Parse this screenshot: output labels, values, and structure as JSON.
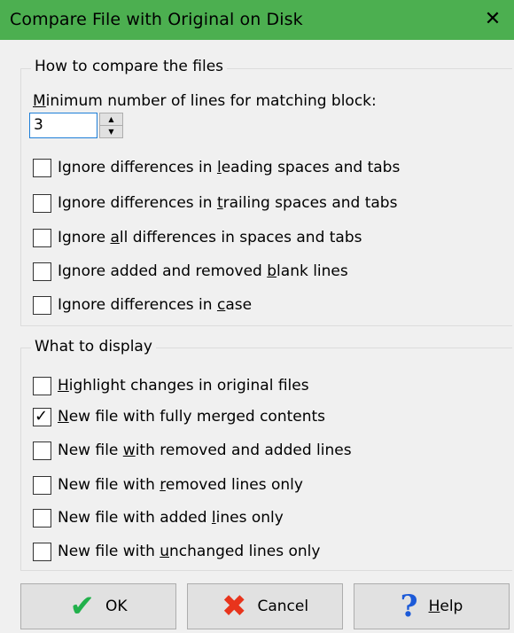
{
  "window": {
    "title": "Compare File with Original on Disk",
    "close_glyph": "✕"
  },
  "compare_group": {
    "legend": "How to compare the files",
    "min_lines_label_mnemonic": "M",
    "min_lines_label_rest": "inimum number of lines for matching block:",
    "min_lines_value": "3",
    "options": [
      {
        "pre": "Ignore differences in ",
        "key": "l",
        "post": "eading spaces and tabs",
        "checked": false
      },
      {
        "pre": "Ignore differences in ",
        "key": "t",
        "post": "railing spaces and tabs",
        "checked": false
      },
      {
        "pre": "Ignore ",
        "key": "a",
        "post": "ll differences in spaces and tabs",
        "checked": false
      },
      {
        "pre": "Ignore added and removed ",
        "key": "b",
        "post": "lank lines",
        "checked": false
      },
      {
        "pre": "Ignore differences in ",
        "key": "c",
        "post": "ase",
        "checked": false
      }
    ]
  },
  "display_group": {
    "legend": "What to display",
    "options": [
      {
        "pre": "",
        "key": "H",
        "post": "ighlight changes in original files",
        "checked": false
      },
      {
        "pre": "",
        "key": "N",
        "post": "ew file with fully merged contents",
        "checked": true
      },
      {
        "pre": "New file ",
        "key": "w",
        "post": "ith removed and added lines",
        "checked": false
      },
      {
        "pre": "New file with ",
        "key": "r",
        "post": "emoved lines only",
        "checked": false
      },
      {
        "pre": "New file with added ",
        "key": "l",
        "post": "ines only",
        "checked": false
      },
      {
        "pre": "New file with ",
        "key": "u",
        "post": "nchanged lines only",
        "checked": false
      }
    ]
  },
  "buttons": {
    "ok": {
      "label": "OK",
      "icon": "checkmark-icon",
      "glyph": "✔"
    },
    "cancel": {
      "label": "Cancel",
      "icon": "cross-icon",
      "glyph": "✖"
    },
    "help": {
      "label_key": "H",
      "label_rest": "elp",
      "icon": "question-icon",
      "glyph": "?"
    }
  },
  "colors": {
    "titlebar": "#4caf50",
    "ok_icon": "#22b14c",
    "cancel_icon": "#e8341c",
    "help_icon": "#1c5ad8"
  }
}
